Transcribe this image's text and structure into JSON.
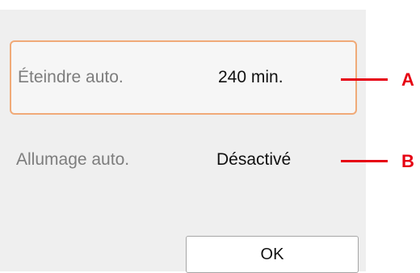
{
  "settings": [
    {
      "label": "Éteindre auto.",
      "value": "240 min."
    },
    {
      "label": "Allumage auto.",
      "value": "Désactivé"
    }
  ],
  "ok_button": {
    "label": "OK"
  },
  "callouts": [
    {
      "letter": "A"
    },
    {
      "letter": "B"
    }
  ],
  "colors": {
    "screen_background": "#efefef",
    "selection_border": "#f0aa78",
    "callout": "#e60012"
  }
}
